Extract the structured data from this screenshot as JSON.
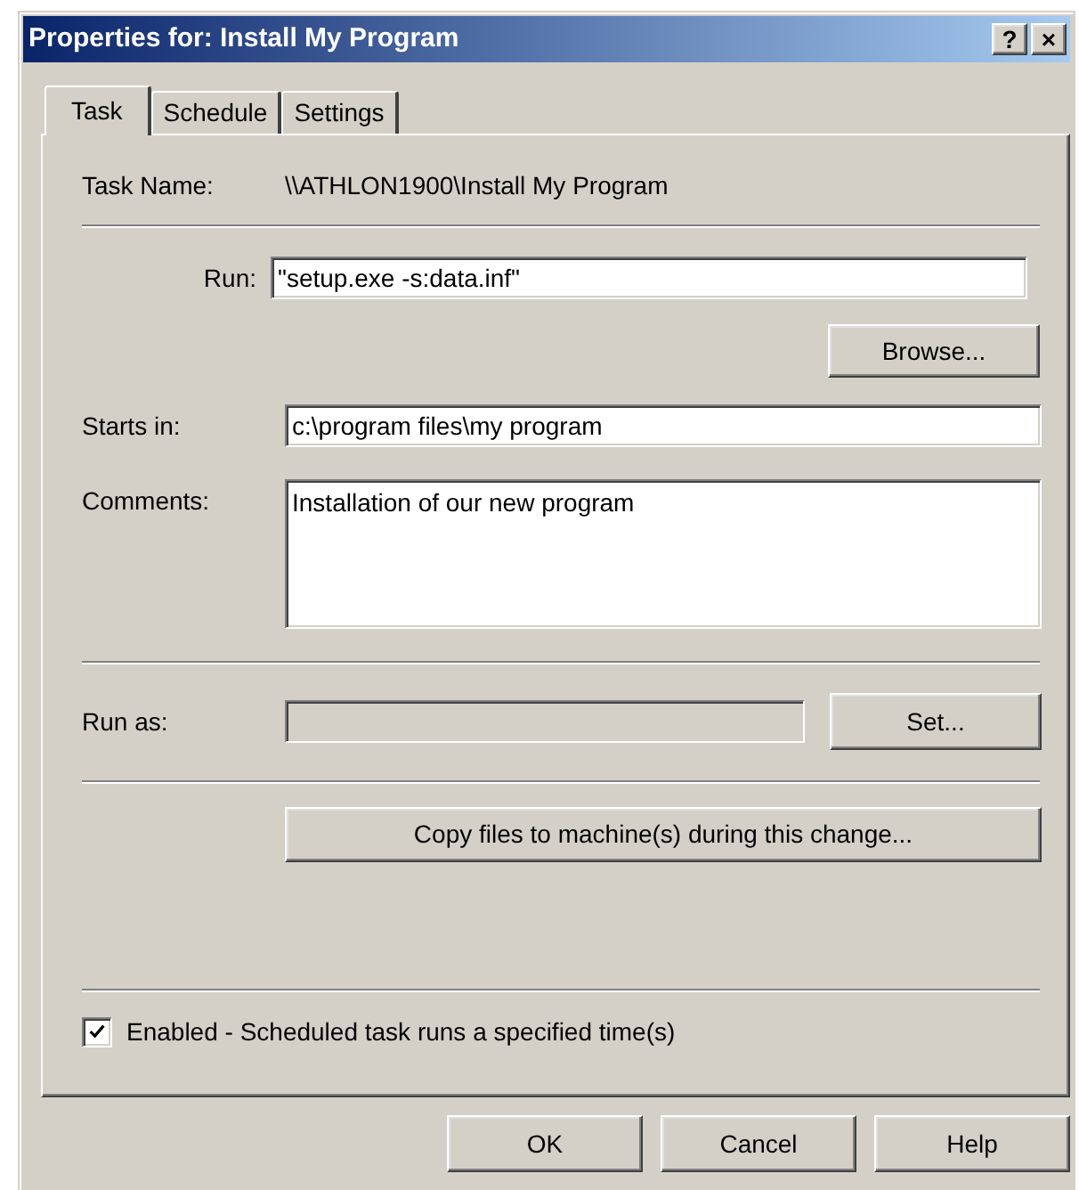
{
  "window": {
    "title": "Properties for: Install My Program",
    "title_buttons": [
      "?",
      "×"
    ]
  },
  "tabs": [
    {
      "label": "Task",
      "selected": true
    },
    {
      "label": "Schedule",
      "selected": false
    },
    {
      "label": "Settings",
      "selected": false
    }
  ],
  "task_name": {
    "label": "Task Name:",
    "value": "\\\\ATHLON1900\\Install My Program"
  },
  "run": {
    "label": "Run:",
    "value": "\"setup.exe -s:data.inf\""
  },
  "browse_button": {
    "label": "Browse..."
  },
  "starts_in": {
    "label": "Starts in:",
    "value": "c:\\program files\\my program"
  },
  "comments": {
    "label": "Comments:",
    "value": "Installation of our new program"
  },
  "run_as": {
    "label": "Run as:",
    "disabled": true
  },
  "set_button": "Set...",
  "copy_button": "Copy files to machine(s) during this change...",
  "enabled": {
    "label": "Enabled - Scheduled task runs a specified time(s)",
    "checked": true
  },
  "buttons": [
    "OK",
    "Cancel",
    "Help"
  ]
}
